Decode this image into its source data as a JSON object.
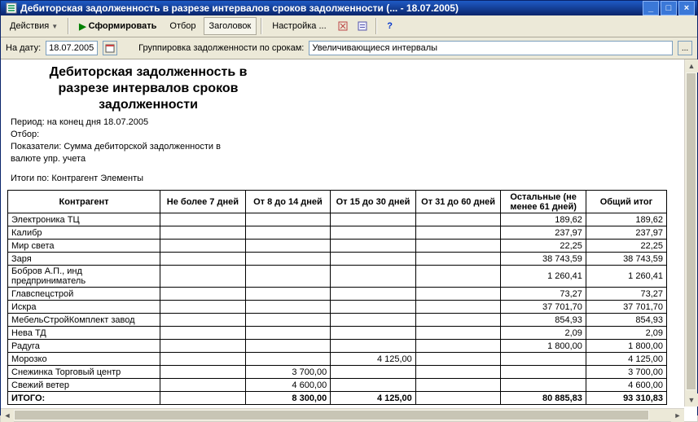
{
  "window": {
    "title": "Дебиторская задолженность в разрезе интервалов сроков задолженности (... - 18.07.2005)"
  },
  "toolbar": {
    "actions": "Действия",
    "form": "Сформировать",
    "filter": "Отбор",
    "header": "Заголовок",
    "settings": "Настройка ..."
  },
  "params": {
    "date_label": "На дату:",
    "date_value": "18.07.2005",
    "group_label": "Группировка задолженности по срокам:",
    "group_value": "Увеличивающиеся интервалы"
  },
  "report": {
    "title_line1": "Дебиторская задолженность в",
    "title_line2": "разрезе интервалов сроков",
    "title_line3": "задолженности",
    "period": "Период: на конец дня 18.07.2005",
    "filter": "Отбор:",
    "indicators": "Показатели:  Сумма дебиторской задолженности в валюте упр. учета",
    "totals_by": "Итоги по:   Контрагент Элементы"
  },
  "columns": {
    "name": "Контрагент",
    "c1": "Не более 7 дней",
    "c2": "От 8 до 14 дней",
    "c3": "От 15 до 30 дней",
    "c4": "От 31 до 60 дней",
    "c5": "Остальные (не менее 61 дней)",
    "total": "Общий итог"
  },
  "rows": [
    {
      "name": "Электроника ТЦ",
      "c1": "",
      "c2": "",
      "c3": "",
      "c4": "",
      "c5": "189,62",
      "total": "189,62"
    },
    {
      "name": "Калибр",
      "c1": "",
      "c2": "",
      "c3": "",
      "c4": "",
      "c5": "237,97",
      "total": "237,97"
    },
    {
      "name": "Мир света",
      "c1": "",
      "c2": "",
      "c3": "",
      "c4": "",
      "c5": "22,25",
      "total": "22,25"
    },
    {
      "name": "Заря",
      "c1": "",
      "c2": "",
      "c3": "",
      "c4": "",
      "c5": "38 743,59",
      "total": "38 743,59"
    },
    {
      "name": "Бобров А.П., инд предприниматель",
      "c1": "",
      "c2": "",
      "c3": "",
      "c4": "",
      "c5": "1 260,41",
      "total": "1 260,41"
    },
    {
      "name": "Главспецстрой",
      "c1": "",
      "c2": "",
      "c3": "",
      "c4": "",
      "c5": "73,27",
      "total": "73,27"
    },
    {
      "name": "Искра",
      "c1": "",
      "c2": "",
      "c3": "",
      "c4": "",
      "c5": "37 701,70",
      "total": "37 701,70"
    },
    {
      "name": "МебельСтройКомплект завод",
      "c1": "",
      "c2": "",
      "c3": "",
      "c4": "",
      "c5": "854,93",
      "total": "854,93"
    },
    {
      "name": "Нева ТД",
      "c1": "",
      "c2": "",
      "c3": "",
      "c4": "",
      "c5": "2,09",
      "total": "2,09"
    },
    {
      "name": "Радуга",
      "c1": "",
      "c2": "",
      "c3": "",
      "c4": "",
      "c5": "1 800,00",
      "total": "1 800,00"
    },
    {
      "name": "Морозко",
      "c1": "",
      "c2": "",
      "c3": "4 125,00",
      "c4": "",
      "c5": "",
      "total": "4 125,00"
    },
    {
      "name": "Снежинка Торговый центр",
      "c1": "",
      "c2": "3 700,00",
      "c3": "",
      "c4": "",
      "c5": "",
      "total": "3 700,00"
    },
    {
      "name": "Свежий ветер",
      "c1": "",
      "c2": "4 600,00",
      "c3": "",
      "c4": "",
      "c5": "",
      "total": "4 600,00"
    }
  ],
  "totals": {
    "name": "ИТОГО:",
    "c1": "",
    "c2": "8 300,00",
    "c3": "4 125,00",
    "c4": "",
    "c5": "80 885,83",
    "total": "93 310,83"
  }
}
